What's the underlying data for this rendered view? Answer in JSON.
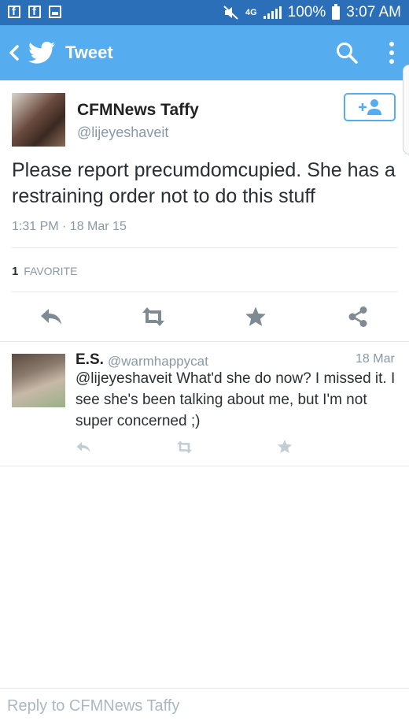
{
  "status_bar": {
    "left_icons": [
      "facebook-icon",
      "facebook-icon",
      "image-icon"
    ],
    "network": "4G",
    "battery": "100%",
    "time": "3:07 AM"
  },
  "app_bar": {
    "title": "Tweet",
    "color": "#55acee"
  },
  "tweet": {
    "author_name": "CFMNews Taffy",
    "author_handle": "@lijeyeshaveit",
    "text": "Please report precumdomcupied. She has a restraining order not to do this stuff",
    "timestamp": "1:31 PM · 18 Mar 15",
    "favorites_count": "1",
    "favorites_label": "FAVORITE",
    "actions": [
      "reply-icon",
      "retweet-icon",
      "favorite-icon",
      "share-icon"
    ]
  },
  "reply": {
    "author_name": "E.S.",
    "author_handle": "@warmhappycat",
    "date": "18 Mar",
    "text": "@lijeyeshaveit What'd she do now?  I missed it.  I see she's been talking about me, but I'm not super concerned ;)",
    "actions": [
      "reply-icon",
      "retweet-icon",
      "favorite-icon"
    ]
  },
  "compose": {
    "placeholder": "Reply to CFMNews Taffy"
  }
}
